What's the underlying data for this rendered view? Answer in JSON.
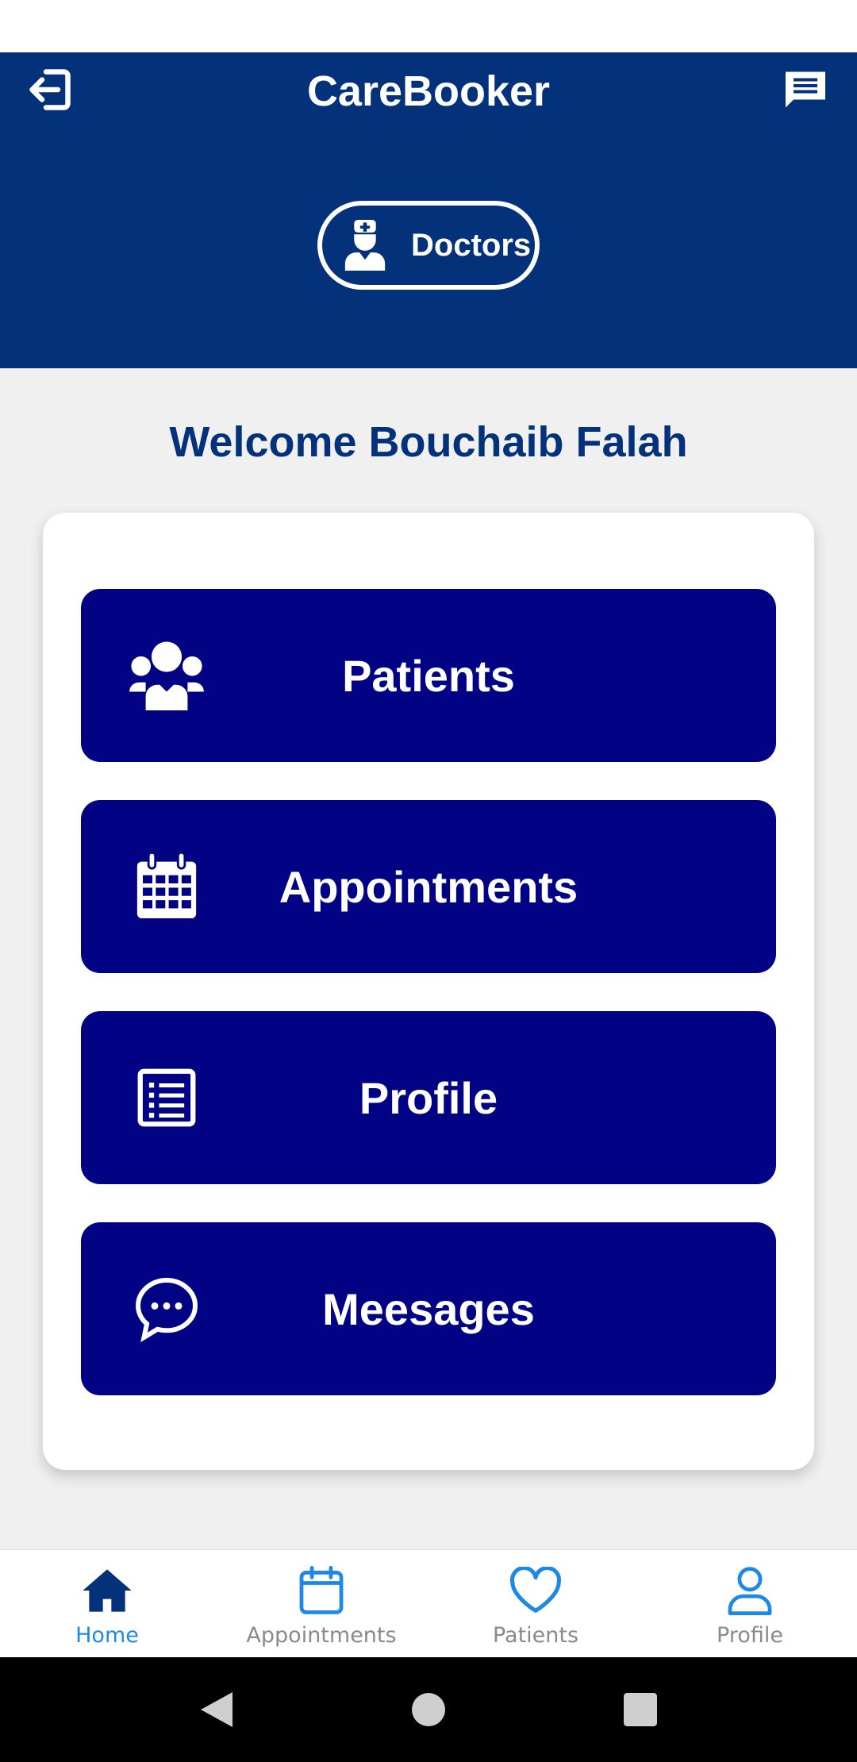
{
  "header": {
    "title": "CareBooker",
    "role_label": "Doctors",
    "logout_icon": "logout-icon",
    "chat_icon": "chat-icon",
    "bg_color": "#03317a"
  },
  "welcome": {
    "text": "Welcome Bouchaib Falah"
  },
  "menu": {
    "items": [
      {
        "label": "Patients",
        "icon": "users-icon"
      },
      {
        "label": "Appointments",
        "icon": "calendar-icon"
      },
      {
        "label": "Profile",
        "icon": "list-icon"
      },
      {
        "label": "Meesages",
        "icon": "chat-bubble-icon"
      }
    ],
    "button_color": "#020285"
  },
  "bottom_nav": {
    "items": [
      {
        "label": "Home",
        "icon": "home-icon",
        "active": true
      },
      {
        "label": "Appointments",
        "icon": "calendar-icon",
        "active": false
      },
      {
        "label": "Patients",
        "icon": "heart-icon",
        "active": false
      },
      {
        "label": "Profile",
        "icon": "user-icon",
        "active": false
      }
    ],
    "active_color": "#1e88e5",
    "inactive_color": "#8a8a8a"
  }
}
